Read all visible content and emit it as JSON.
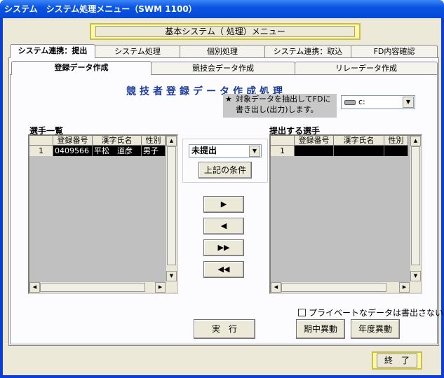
{
  "window": {
    "title": "システム　システム処理メニュー（SWM 1100）"
  },
  "banner": {
    "text": "基本システム（ 処理）メニュー"
  },
  "tabs_top": [
    "システム連携：提出",
    "システム処理",
    "個別処理",
    "システム連携：取込",
    "FD内容確認"
  ],
  "tabs_sub": [
    "登録データ作成",
    "競技会データ作成",
    "リレーデータ作成"
  ],
  "main_title": "競技者登録データ作成処理",
  "note": {
    "star": "★",
    "line1": "対象データを抽出してFDに",
    "line2": "書き出し(出力)します。"
  },
  "drive": {
    "value": "c:"
  },
  "left_list": {
    "label": "選手一覧",
    "columns": [
      "登録番号",
      "漢字氏名",
      "性別"
    ],
    "rows": [
      {
        "no": "1",
        "reg": "0409566",
        "name": "平松　道彦",
        "sex": "男子"
      }
    ]
  },
  "filter": {
    "combo": "未提出",
    "button": "上記の条件"
  },
  "arrows": {
    "add": "▶",
    "remove": "◀",
    "add_all": "▶▶",
    "remove_all": "◀◀"
  },
  "right_list": {
    "label": "提出する選手",
    "columns": [
      "登録番号",
      "漢字氏名",
      "性別"
    ],
    "rows": [
      {
        "no": "1"
      }
    ]
  },
  "private_check": "プライベートなデータは書出さない",
  "buttons": {
    "execute": "実　行",
    "mid_term": "期中異動",
    "annual": "年度異動",
    "exit": "終　了"
  }
}
